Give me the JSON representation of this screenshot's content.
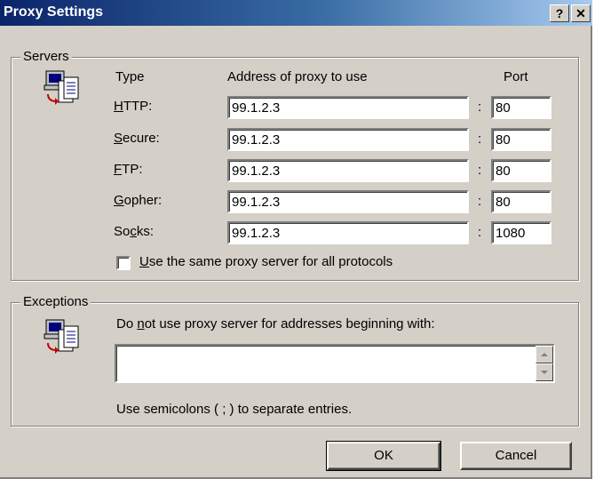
{
  "window": {
    "title": "Proxy Settings",
    "help_button": "?",
    "close_button": "✕"
  },
  "servers": {
    "legend": "Servers",
    "col_type": "Type",
    "col_address": "Address of proxy to use",
    "col_port": "Port",
    "rows": [
      {
        "label_pre": "",
        "label_u": "H",
        "label_post": "TTP:",
        "address": "99.1.2.3",
        "port": "80"
      },
      {
        "label_pre": "",
        "label_u": "S",
        "label_post": "ecure:",
        "address": "99.1.2.3",
        "port": "80"
      },
      {
        "label_pre": "",
        "label_u": "F",
        "label_post": "TP:",
        "address": "99.1.2.3",
        "port": "80"
      },
      {
        "label_pre": "",
        "label_u": "G",
        "label_post": "opher:",
        "address": "99.1.2.3",
        "port": "80"
      },
      {
        "label_pre": "So",
        "label_u": "c",
        "label_post": "ks:",
        "address": "99.1.2.3",
        "port": "1080"
      }
    ],
    "colon": ":",
    "same_proxy": {
      "u": "U",
      "rest": "se the same proxy server for all protocols",
      "checked": false
    }
  },
  "exceptions": {
    "legend": "Exceptions",
    "desc_pre": "Do ",
    "desc_u": "n",
    "desc_post": "ot use proxy server for addresses beginning with:",
    "value": "",
    "hint": "Use semicolons ( ; ) to separate entries."
  },
  "buttons": {
    "ok": "OK",
    "cancel": "Cancel"
  },
  "icons": {
    "servers": "network-computer-icon",
    "exceptions": "network-computer-icon"
  }
}
